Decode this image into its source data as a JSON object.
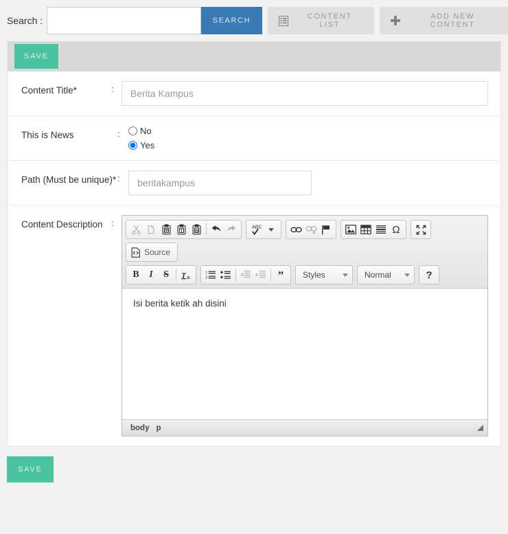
{
  "topbar": {
    "search_label": "Search :",
    "search_value": "",
    "search_placeholder": "",
    "search_button": "SEARCH",
    "content_list_button": "CONTENT LIST",
    "add_new_content_button": "ADD NEW CONTENT"
  },
  "panel": {
    "save_label": "SAVE",
    "save_bottom_label": "SAVE",
    "colon": ":"
  },
  "form": {
    "title_label": "Content Title*",
    "title_value": "Berita Kampus",
    "news_label": "This is News",
    "news_options": [
      {
        "label": "No",
        "value": "no",
        "checked": false
      },
      {
        "label": "Yes",
        "value": "yes",
        "checked": true
      }
    ],
    "path_label": "Path (Must be unique)*",
    "path_value": "beritakampus",
    "description_label": "Content Description"
  },
  "editor": {
    "content": "Isi berita ketik ah disini",
    "source_label": "Source",
    "styles_label": "Styles",
    "format_label": "Normal",
    "help_label": "?",
    "elements_path": [
      "body",
      "p"
    ],
    "toolbar_row1": [
      {
        "name": "cut",
        "title": "Cut",
        "disabled": true
      },
      {
        "name": "copy",
        "title": "Copy",
        "disabled": true
      },
      {
        "name": "paste",
        "title": "Paste",
        "disabled": false
      },
      {
        "name": "paste-text",
        "title": "Paste as plain text",
        "disabled": false
      },
      {
        "name": "paste-word",
        "title": "Paste from Word",
        "disabled": false
      },
      {
        "name": "undo",
        "title": "Undo",
        "disabled": false
      },
      {
        "name": "redo",
        "title": "Redo",
        "disabled": true
      }
    ],
    "toolbar_spell": [
      {
        "name": "spellcheck",
        "title": "Spell Check As You Type",
        "disabled": false
      }
    ],
    "toolbar_links": [
      {
        "name": "link",
        "title": "Link",
        "disabled": false
      },
      {
        "name": "unlink",
        "title": "Unlink",
        "disabled": true
      },
      {
        "name": "anchor",
        "title": "Anchor",
        "disabled": false
      }
    ],
    "toolbar_insert": [
      {
        "name": "image",
        "title": "Image",
        "disabled": false
      },
      {
        "name": "table",
        "title": "Table",
        "disabled": false
      },
      {
        "name": "horizontal-rule",
        "title": "Horizontal Line",
        "disabled": false
      },
      {
        "name": "special-char",
        "title": "Insert Special Character",
        "disabled": false
      }
    ],
    "toolbar_maximize": [
      {
        "name": "maximize",
        "title": "Maximize",
        "disabled": false
      }
    ],
    "toolbar_basicstyles": [
      {
        "name": "bold",
        "title": "Bold",
        "disabled": false
      },
      {
        "name": "italic",
        "title": "Italic",
        "disabled": false
      },
      {
        "name": "strike",
        "title": "Strikethrough",
        "disabled": false
      },
      {
        "name": "remove-format",
        "title": "Remove Format",
        "disabled": false
      }
    ],
    "toolbar_paragraph": [
      {
        "name": "numbered-list",
        "title": "Insert/Remove Numbered List",
        "disabled": false
      },
      {
        "name": "bulleted-list",
        "title": "Insert/Remove Bulleted List",
        "disabled": false
      },
      {
        "name": "outdent",
        "title": "Decrease Indent",
        "disabled": true
      },
      {
        "name": "indent",
        "title": "Increase Indent",
        "disabled": true
      },
      {
        "name": "blockquote",
        "title": "Block Quote",
        "disabled": false
      }
    ]
  },
  "colors": {
    "accent_blue": "#3b7bb5",
    "accent_green": "#4ac4a0",
    "page_bg": "#f2f2f2",
    "panel_head_bg": "#d9d9d9",
    "topbtn_bg": "#e0e0e0"
  }
}
